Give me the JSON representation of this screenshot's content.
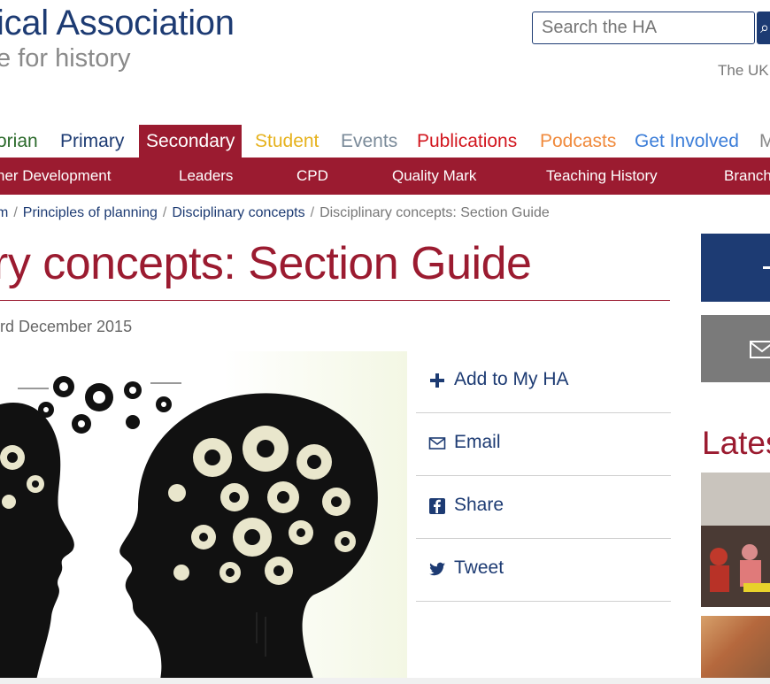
{
  "header": {
    "logo_title": "ical Association",
    "logo_subtitle": "e for history",
    "search_placeholder": "Search the HA",
    "tagline": "The UK"
  },
  "nav": {
    "tabs": [
      {
        "label": "orian",
        "color": "#2b6a2b"
      },
      {
        "label": "Primary",
        "color": "#1d3b73"
      },
      {
        "label": "Secondary",
        "color": "#ffffff",
        "active": true
      },
      {
        "label": "Student",
        "color": "#e6b21e"
      },
      {
        "label": "Events",
        "color": "#7a8a99"
      },
      {
        "label": "Publications",
        "color": "#d2161e"
      },
      {
        "label": "Podcasts",
        "color": "#f08a3c"
      },
      {
        "label": "Get Involved",
        "color": "#3b7dd8"
      },
      {
        "label": "M",
        "color": "#888888"
      }
    ]
  },
  "subnav": {
    "items": [
      "her Development",
      "Leaders",
      "CPD",
      "Quality Mark",
      "Teaching History",
      "Branch"
    ]
  },
  "breadcrumb": {
    "items": [
      "m",
      "Principles of planning",
      "Disciplinary concepts"
    ],
    "current": "Disciplinary concepts: Section Guide"
  },
  "page": {
    "title": "ry concepts: Section Guide",
    "date": "rd December 2015"
  },
  "share": {
    "items": [
      {
        "label": "Add to My HA",
        "icon": "plus-icon"
      },
      {
        "label": "Email",
        "icon": "envelope-icon"
      },
      {
        "label": "Share",
        "icon": "facebook-icon"
      },
      {
        "label": "Tweet",
        "icon": "twitter-icon"
      }
    ]
  },
  "sidebar": {
    "latest_heading": "Lates"
  },
  "colors": {
    "brand_navy": "#1d3b73",
    "brand_red": "#9b1b30"
  }
}
